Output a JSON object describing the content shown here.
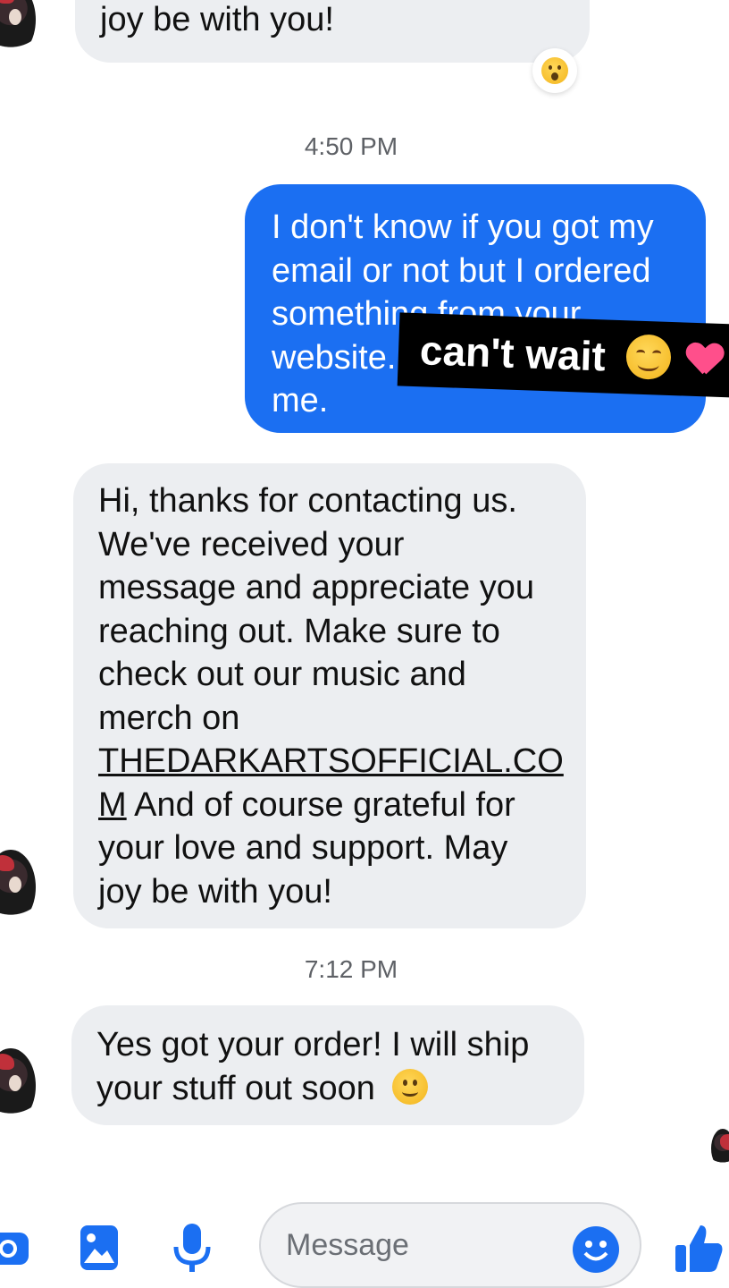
{
  "messages": {
    "top_partial": "joy be with you!",
    "time1": "4:50 PM",
    "outgoing_lines": [
      "I don't know if you got my",
      "email or not but I ordered",
      "something from your",
      "website.",
      "me."
    ],
    "overlay_text": "can't wait",
    "reply1_lines": [
      "Hi, thanks for contacting us.",
      "We've received your",
      "message and appreciate you",
      "reaching out. Make sure to",
      "check out our music and",
      "merch on",
      "THEDARKARTSOFFICIAL.CO",
      "M",
      " And of course grateful for",
      "your love and support. May",
      "joy be with you!"
    ],
    "time2": "7:12 PM",
    "reply2_lines": [
      "Yes got your order! I will ship",
      "your stuff out soon"
    ]
  },
  "composer": {
    "placeholder": "Message"
  },
  "colors": {
    "outgoing_bubble": "#1b6ff2",
    "incoming_bubble": "#eceef1",
    "accent": "#1b6ff2"
  },
  "icons": [
    "camera-icon",
    "image-icon",
    "microphone-icon",
    "emoji-icon",
    "thumbs-up-icon",
    "wow-reaction-icon",
    "smile-emoji-icon",
    "heart-emoji-icon"
  ]
}
